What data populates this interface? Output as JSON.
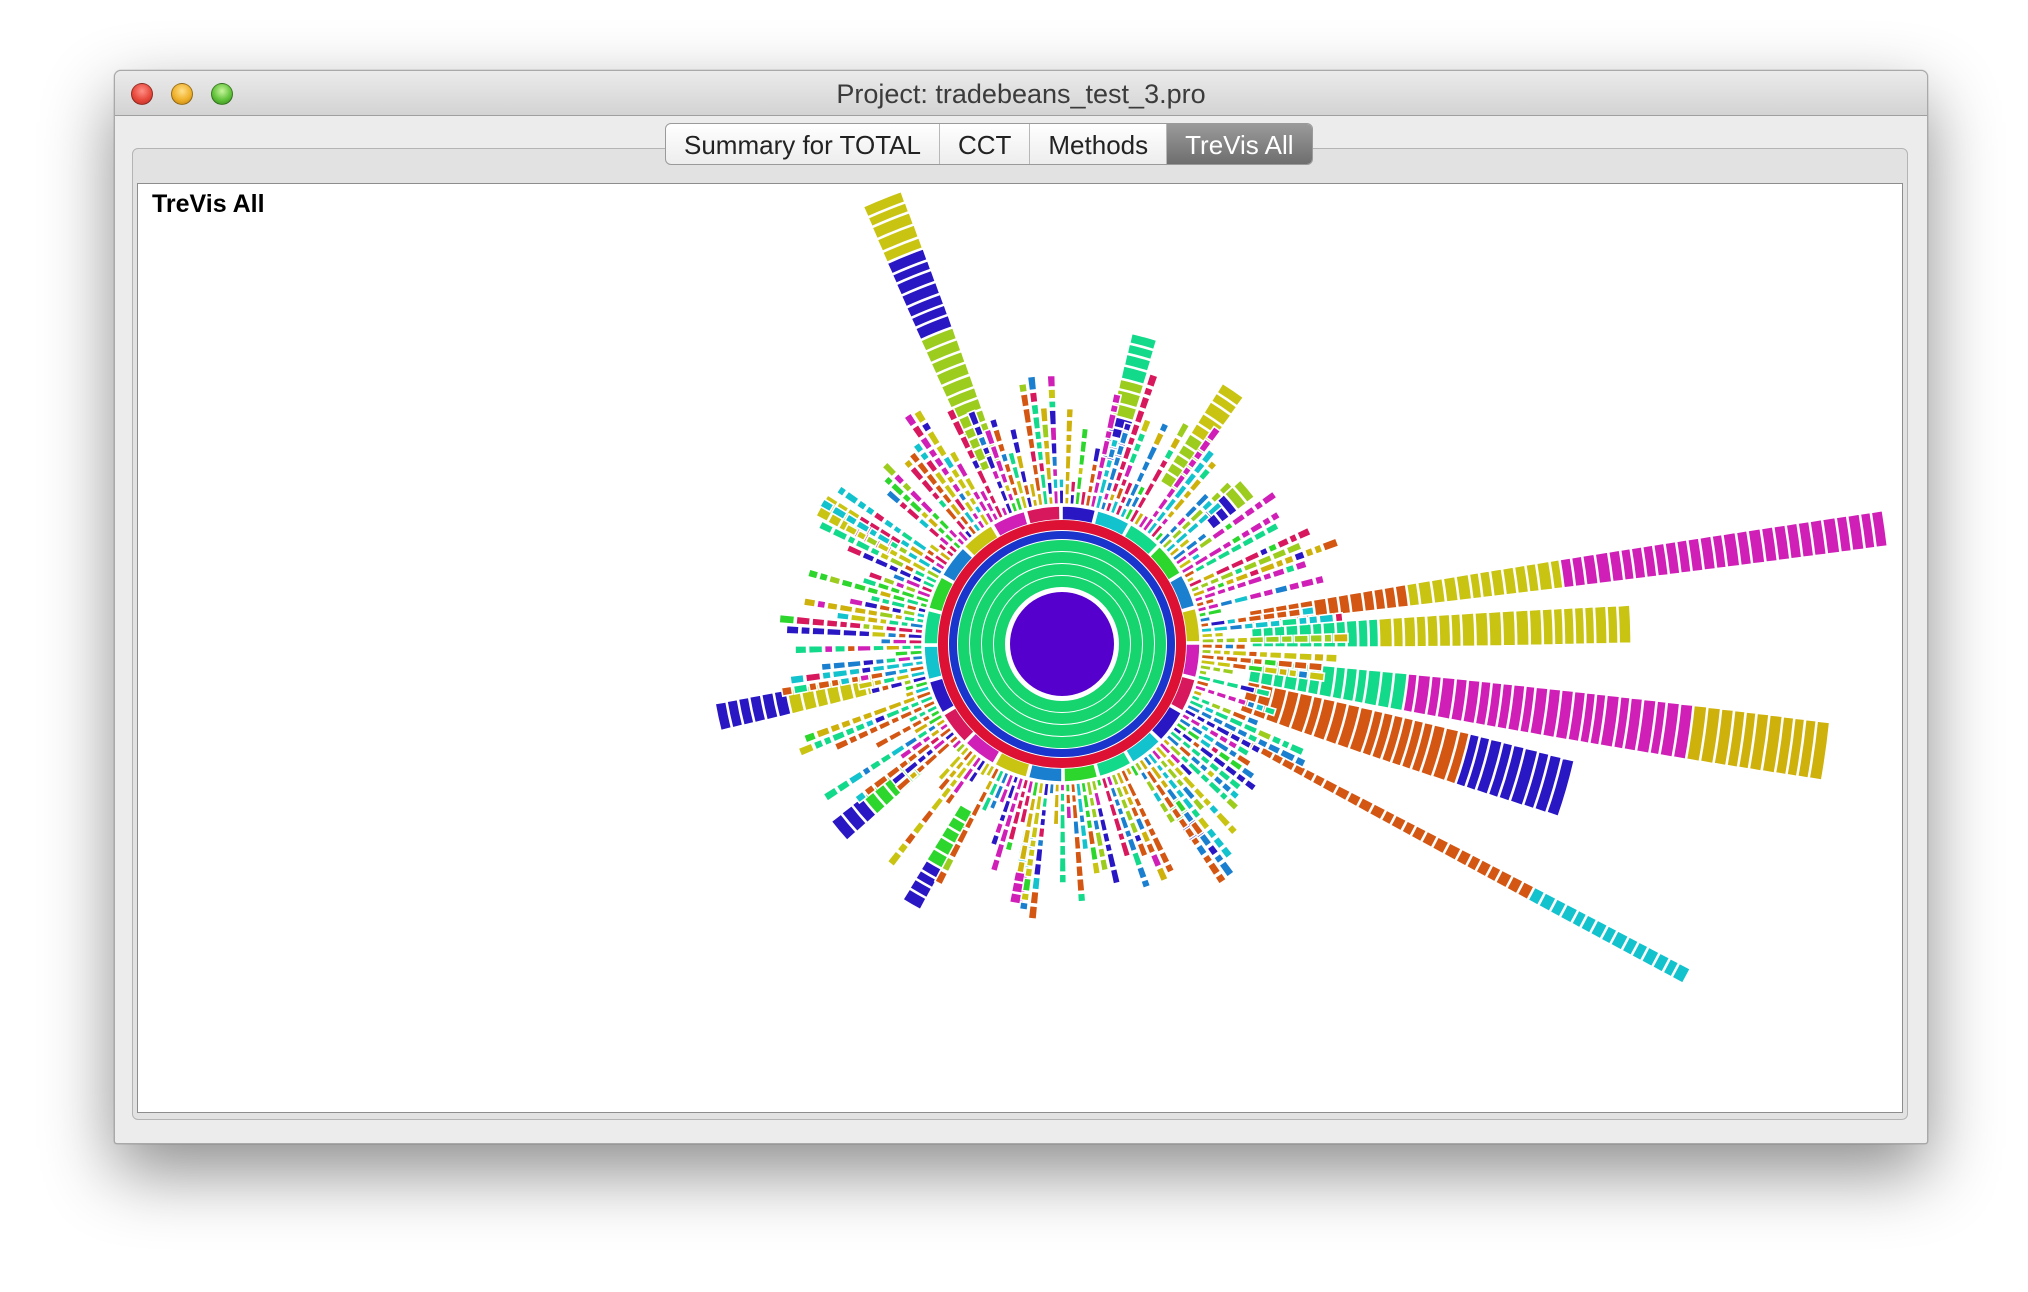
{
  "window": {
    "title": "Project: tradebeans_test_3.pro"
  },
  "tabs": [
    {
      "label": "Summary for TOTAL",
      "active": false
    },
    {
      "label": "CCT",
      "active": false
    },
    {
      "label": "Methods",
      "active": false
    },
    {
      "label": "TreVis All",
      "active": true
    }
  ],
  "view": {
    "title": "TreVis All"
  },
  "palette": {
    "root": "#5500cc",
    "rings": [
      "#16d46e",
      "#1a35cc",
      "#dd1133",
      "#12c2cc"
    ],
    "branches": [
      "#9ccc1e",
      "#c9c412",
      "#2cd62c",
      "#12c2cc",
      "#d01fb7",
      "#d8185d",
      "#2a17c4",
      "#d35713",
      "#13d98a",
      "#1a7fcf",
      "#cfb10c"
    ]
  }
}
